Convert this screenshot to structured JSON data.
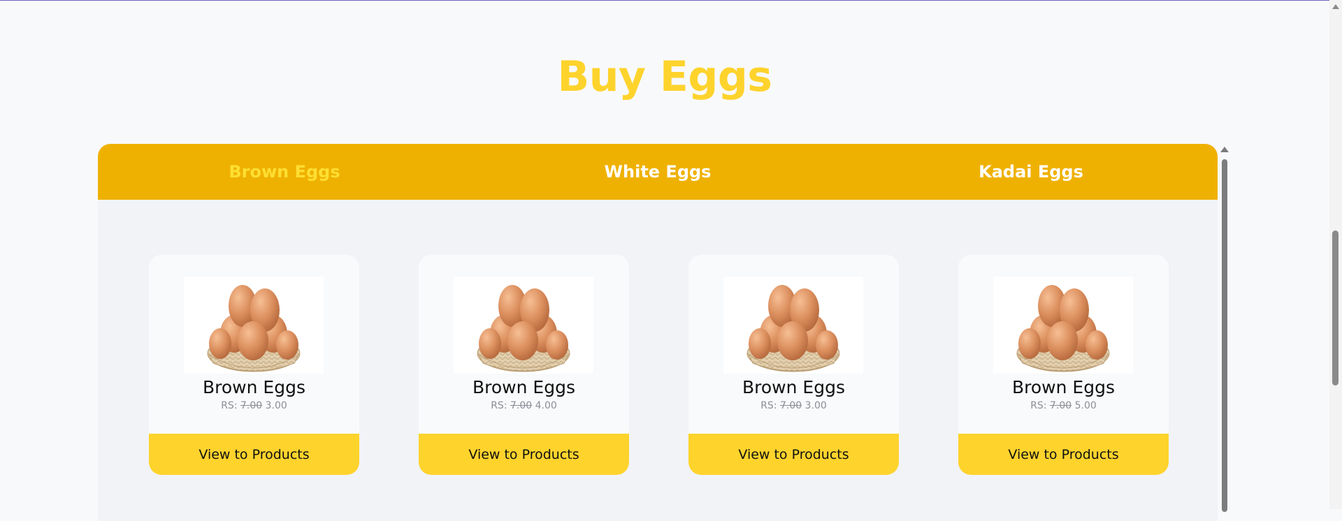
{
  "page": {
    "title": "Buy Eggs",
    "accent_color": "#fed32c",
    "tab_bar_color": "#efb101"
  },
  "tabs": [
    {
      "label": "Brown Eggs",
      "active": true
    },
    {
      "label": "White Eggs",
      "active": false
    },
    {
      "label": "Kadai Eggs",
      "active": false
    }
  ],
  "products": [
    {
      "name": "Brown Eggs",
      "currency": "RS:",
      "old_price": "7.00",
      "price": "3.00",
      "button": "View to Products",
      "image": "egg-basket-image"
    },
    {
      "name": "Brown Eggs",
      "currency": "RS:",
      "old_price": "7.00",
      "price": "4.00",
      "button": "View to Products",
      "image": "egg-basket-image"
    },
    {
      "name": "Brown Eggs",
      "currency": "RS:",
      "old_price": "7.00",
      "price": "3.00",
      "button": "View to Products",
      "image": "egg-basket-image"
    },
    {
      "name": "Brown Eggs",
      "currency": "RS:",
      "old_price": "7.00",
      "price": "5.00",
      "button": "View to Products",
      "image": "egg-basket-image"
    }
  ]
}
